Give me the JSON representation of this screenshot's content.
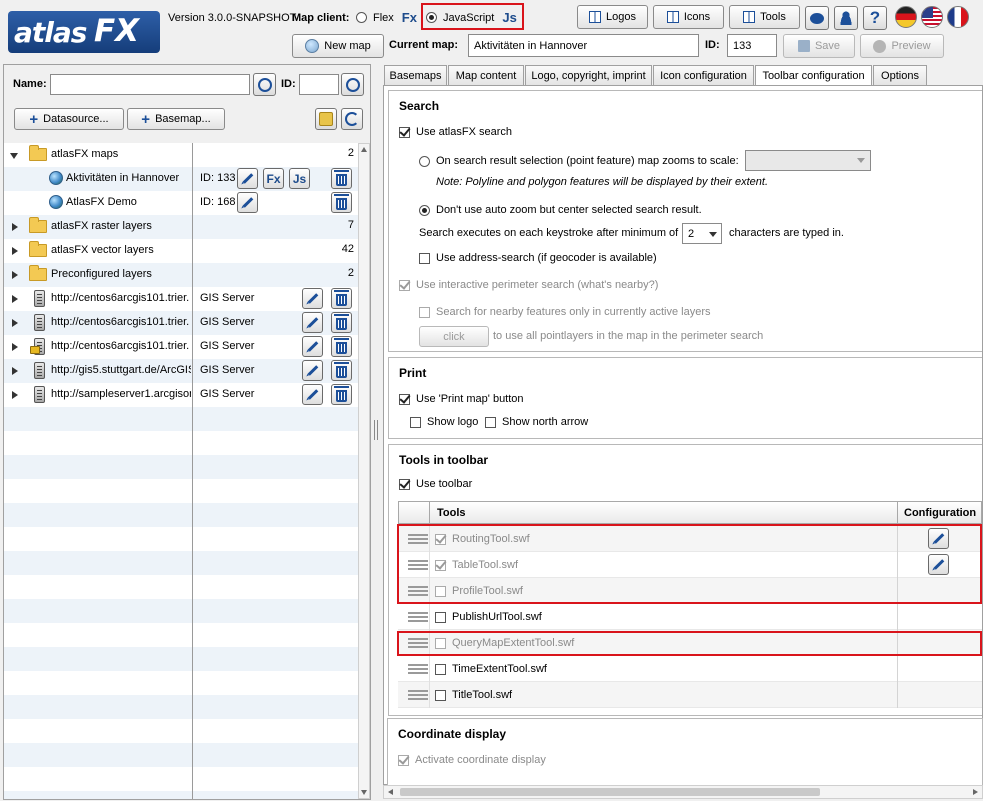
{
  "header": {
    "logo_text": "atlasFX",
    "logo_left": "atlas",
    "logo_right": "FX",
    "version": "Version 3.0.0-SNAPSHOT",
    "map_client_label": "Map client:",
    "client_flex": "Flex",
    "client_flex_badge": "Fx",
    "client_js": "JavaScript",
    "client_js_badge": "Js",
    "logos_btn": "Logos",
    "icons_btn": "Icons",
    "tools_btn": "Tools",
    "new_map_btn": "New map",
    "current_map_label": "Current map:",
    "current_map_value": "Aktivitäten in Hannover",
    "id_label": "ID:",
    "id_value": "133",
    "save_btn": "Save",
    "preview_btn": "Preview",
    "colors": {
      "accent": "#1c4f99",
      "highlight": "#d9141b"
    }
  },
  "left": {
    "name_label": "Name:",
    "id_label": "ID:",
    "datasource_btn": "Datasource...",
    "basemap_btn": "Basemap...",
    "tree": [
      {
        "name": "atlasFX maps",
        "count": "2"
      },
      {
        "name": "Aktivitäten in Hannover",
        "info": "ID: 133"
      },
      {
        "name": "AtlasFX Demo",
        "info": "ID: 168"
      },
      {
        "name": "atlasFX raster layers",
        "count": "7"
      },
      {
        "name": "atlasFX vector layers",
        "count": "42"
      },
      {
        "name": "Preconfigured layers",
        "count": "2"
      },
      {
        "name": "http://centos6arcgis101.trier.",
        "info": "GIS Server"
      },
      {
        "name": "http://centos6arcgis101.trier.",
        "info": "GIS Server"
      },
      {
        "name": "http://centos6arcgis101.trier.",
        "info": "GIS Server"
      },
      {
        "name": "http://gis5.stuttgart.de/ArcGIS",
        "info": "GIS Server"
      },
      {
        "name": "http://sampleserver1.arcgisor",
        "info": "GIS Server"
      }
    ]
  },
  "tabs": [
    "Basemaps",
    "Map content",
    "Logo, copyright, imprint",
    "Icon configuration",
    "Toolbar configuration",
    "Options"
  ],
  "search": {
    "title": "Search",
    "use_search": "Use atlasFX search",
    "zoom_option": "On search result selection (point feature) map zooms to scale:",
    "zoom_note": "Note: Polyline and polygon features will be displayed by their extent.",
    "center_option": "Don't use auto zoom but center selected search result.",
    "keystroke_pre": "Search executes on each keystroke after minimum of",
    "keystroke_value": "2",
    "keystroke_post": "characters are typed in.",
    "address_search": "Use address-search (if geocoder is available)",
    "perimeter": "Use interactive perimeter search (what's nearby?)",
    "nearby_active": "Search for nearby features only in currently active layers",
    "click_btn": "click",
    "click_note": "to use all pointlayers in the map in the perimeter search"
  },
  "print": {
    "title": "Print",
    "use_print": "Use 'Print map' button",
    "show_logo": "Show logo",
    "show_north": "Show north arrow"
  },
  "toolbar": {
    "title": "Tools in toolbar",
    "use_toolbar": "Use toolbar",
    "col_tools": "Tools",
    "col_config": "Configuration",
    "tools": [
      {
        "name": "RoutingTool.swf",
        "checked": true,
        "disabled": true,
        "config": true
      },
      {
        "name": "TableTool.swf",
        "checked": true,
        "disabled": true,
        "config": true
      },
      {
        "name": "ProfileTool.swf",
        "checked": false,
        "disabled": true,
        "config": false
      },
      {
        "name": "PublishUrlTool.swf",
        "checked": false,
        "disabled": false,
        "config": false
      },
      {
        "name": "QueryMapExtentTool.swf",
        "checked": false,
        "disabled": true,
        "config": false
      },
      {
        "name": "TimeExtentTool.swf",
        "checked": false,
        "disabled": false,
        "config": false
      },
      {
        "name": "TitleTool.swf",
        "checked": false,
        "disabled": false,
        "config": false
      }
    ]
  },
  "coord": {
    "title": "Coordinate display",
    "activate": "Activate coordinate display"
  }
}
